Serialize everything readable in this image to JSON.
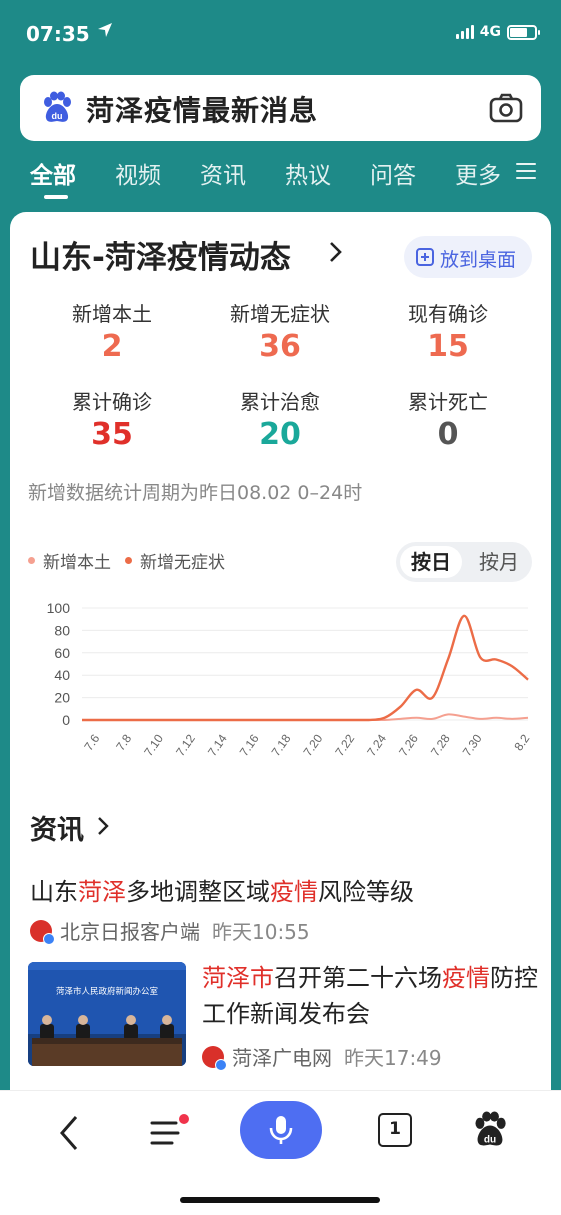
{
  "status_bar": {
    "time": "07:35",
    "network": "4G",
    "battery_level": 0.7
  },
  "search": {
    "query": "菏泽疫情最新消息"
  },
  "tabs": [
    {
      "label": "全部",
      "active": true
    },
    {
      "label": "视频"
    },
    {
      "label": "资讯"
    },
    {
      "label": "热议"
    },
    {
      "label": "问答"
    },
    {
      "label": "更多"
    }
  ],
  "card": {
    "title": "山东-菏泽疫情动态",
    "desktop_button": "放到桌面",
    "stats": [
      {
        "label": "新增本土",
        "value": "2",
        "color": "#ee6a50"
      },
      {
        "label": "新增无症状",
        "value": "36",
        "color": "#ee6a50"
      },
      {
        "label": "现有确诊",
        "value": "15",
        "color": "#ee6a50"
      },
      {
        "label": "累计确诊",
        "value": "35",
        "color": "#e0302a"
      },
      {
        "label": "累计治愈",
        "value": "20",
        "color": "#1aa89a"
      },
      {
        "label": "累计死亡",
        "value": "0",
        "color": "#555555"
      }
    ],
    "note": "新增数据统计周期为昨日08.02 0–24时",
    "toggle": {
      "on": "按日",
      "off": "按月"
    }
  },
  "chart_data": {
    "type": "line",
    "x": [
      "7.5",
      "7.6",
      "7.7",
      "7.8",
      "7.9",
      "7.10",
      "7.11",
      "7.12",
      "7.13",
      "7.14",
      "7.15",
      "7.16",
      "7.17",
      "7.18",
      "7.19",
      "7.20",
      "7.21",
      "7.22",
      "7.23",
      "7.24",
      "7.25",
      "7.26",
      "7.27",
      "7.28",
      "7.29",
      "7.30",
      "7.31",
      "8.1",
      "8.2"
    ],
    "tick_labels": [
      "7.6",
      "7.8",
      "7.10",
      "7.12",
      "7.14",
      "7.16",
      "7.18",
      "7.20",
      "7.22",
      "7.24",
      "7.26",
      "7.28",
      "7.30",
      "8.2"
    ],
    "series": [
      {
        "name": "新增本土",
        "color": "#f5a090",
        "values": [
          0,
          0,
          0,
          0,
          0,
          0,
          0,
          0,
          0,
          0,
          0,
          0,
          0,
          0,
          0,
          0,
          0,
          0,
          0,
          0,
          1,
          2,
          1,
          5,
          3,
          1,
          2,
          1,
          2
        ]
      },
      {
        "name": "新增无症状",
        "color": "#ec6c47",
        "values": [
          0,
          0,
          0,
          0,
          0,
          0,
          0,
          0,
          0,
          0,
          0,
          0,
          0,
          0,
          0,
          0,
          0,
          0,
          0,
          2,
          12,
          27,
          20,
          55,
          93,
          56,
          54,
          48,
          36
        ]
      }
    ],
    "y_ticks": [
      0,
      20,
      40,
      60,
      80,
      100
    ],
    "ylim": [
      0,
      100
    ],
    "grid": true,
    "legend_position": "top-left"
  },
  "news": {
    "heading": "资讯",
    "item1": {
      "title_parts": [
        {
          "text": "山东",
          "hl": false
        },
        {
          "text": "菏泽",
          "hl": true
        },
        {
          "text": "多地调整区域",
          "hl": false
        },
        {
          "text": "疫情",
          "hl": true
        },
        {
          "text": "风险等级",
          "hl": false
        }
      ],
      "source": "北京日报客户端",
      "time": "昨天10:55"
    },
    "item2": {
      "title_parts": [
        {
          "text": "菏泽市",
          "hl": true
        },
        {
          "text": "召开第二十六场",
          "hl": false
        },
        {
          "text": "疫情",
          "hl": true
        },
        {
          "text": "防控工作新闻发布会",
          "hl": false
        }
      ],
      "thumb_banner": "菏泽市人民政府新闻办公室",
      "source": "菏泽广电网",
      "time": "昨天17:49"
    }
  },
  "bottom_bar": {
    "tab_count": "1"
  }
}
